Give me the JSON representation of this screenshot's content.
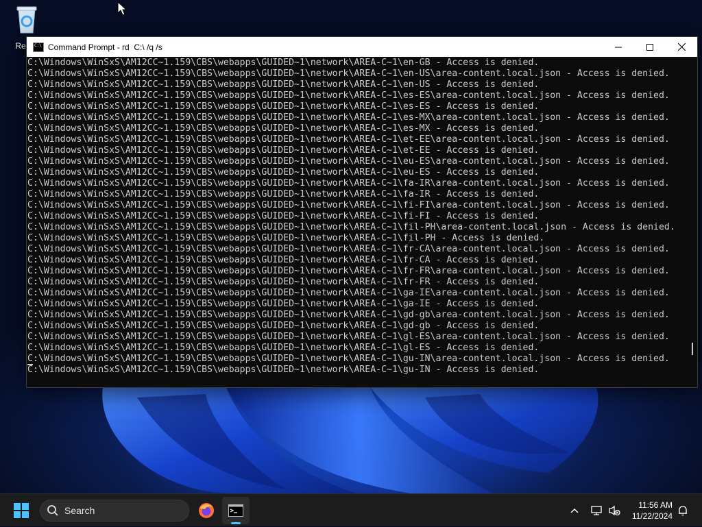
{
  "desktop": {
    "recycle_bin_label": "Recyc"
  },
  "window": {
    "title": "Command Prompt - rd  C:\\ /q /s",
    "controls": {
      "minimize": "minimize-icon",
      "maximize": "maximize-icon",
      "close": "close-icon"
    },
    "console_lines": [
      "C:\\Windows\\WinSxS\\AM12CC~1.159\\CBS\\webapps\\GUIDED~1\\network\\AREA-C~1\\en-GB - Access is denied.",
      "C:\\Windows\\WinSxS\\AM12CC~1.159\\CBS\\webapps\\GUIDED~1\\network\\AREA-C~1\\en-US\\area-content.local.json - Access is denied.",
      "C:\\Windows\\WinSxS\\AM12CC~1.159\\CBS\\webapps\\GUIDED~1\\network\\AREA-C~1\\en-US - Access is denied.",
      "C:\\Windows\\WinSxS\\AM12CC~1.159\\CBS\\webapps\\GUIDED~1\\network\\AREA-C~1\\es-ES\\area-content.local.json - Access is denied.",
      "C:\\Windows\\WinSxS\\AM12CC~1.159\\CBS\\webapps\\GUIDED~1\\network\\AREA-C~1\\es-ES - Access is denied.",
      "C:\\Windows\\WinSxS\\AM12CC~1.159\\CBS\\webapps\\GUIDED~1\\network\\AREA-C~1\\es-MX\\area-content.local.json - Access is denied.",
      "C:\\Windows\\WinSxS\\AM12CC~1.159\\CBS\\webapps\\GUIDED~1\\network\\AREA-C~1\\es-MX - Access is denied.",
      "C:\\Windows\\WinSxS\\AM12CC~1.159\\CBS\\webapps\\GUIDED~1\\network\\AREA-C~1\\et-EE\\area-content.local.json - Access is denied.",
      "C:\\Windows\\WinSxS\\AM12CC~1.159\\CBS\\webapps\\GUIDED~1\\network\\AREA-C~1\\et-EE - Access is denied.",
      "C:\\Windows\\WinSxS\\AM12CC~1.159\\CBS\\webapps\\GUIDED~1\\network\\AREA-C~1\\eu-ES\\area-content.local.json - Access is denied.",
      "C:\\Windows\\WinSxS\\AM12CC~1.159\\CBS\\webapps\\GUIDED~1\\network\\AREA-C~1\\eu-ES - Access is denied.",
      "C:\\Windows\\WinSxS\\AM12CC~1.159\\CBS\\webapps\\GUIDED~1\\network\\AREA-C~1\\fa-IR\\area-content.local.json - Access is denied.",
      "C:\\Windows\\WinSxS\\AM12CC~1.159\\CBS\\webapps\\GUIDED~1\\network\\AREA-C~1\\fa-IR - Access is denied.",
      "C:\\Windows\\WinSxS\\AM12CC~1.159\\CBS\\webapps\\GUIDED~1\\network\\AREA-C~1\\fi-FI\\area-content.local.json - Access is denied.",
      "C:\\Windows\\WinSxS\\AM12CC~1.159\\CBS\\webapps\\GUIDED~1\\network\\AREA-C~1\\fi-FI - Access is denied.",
      "C:\\Windows\\WinSxS\\AM12CC~1.159\\CBS\\webapps\\GUIDED~1\\network\\AREA-C~1\\fil-PH\\area-content.local.json - Access is denied.",
      "C:\\Windows\\WinSxS\\AM12CC~1.159\\CBS\\webapps\\GUIDED~1\\network\\AREA-C~1\\fil-PH - Access is denied.",
      "C:\\Windows\\WinSxS\\AM12CC~1.159\\CBS\\webapps\\GUIDED~1\\network\\AREA-C~1\\fr-CA\\area-content.local.json - Access is denied.",
      "C:\\Windows\\WinSxS\\AM12CC~1.159\\CBS\\webapps\\GUIDED~1\\network\\AREA-C~1\\fr-CA - Access is denied.",
      "C:\\Windows\\WinSxS\\AM12CC~1.159\\CBS\\webapps\\GUIDED~1\\network\\AREA-C~1\\fr-FR\\area-content.local.json - Access is denied.",
      "C:\\Windows\\WinSxS\\AM12CC~1.159\\CBS\\webapps\\GUIDED~1\\network\\AREA-C~1\\fr-FR - Access is denied.",
      "C:\\Windows\\WinSxS\\AM12CC~1.159\\CBS\\webapps\\GUIDED~1\\network\\AREA-C~1\\ga-IE\\area-content.local.json - Access is denied.",
      "C:\\Windows\\WinSxS\\AM12CC~1.159\\CBS\\webapps\\GUIDED~1\\network\\AREA-C~1\\ga-IE - Access is denied.",
      "C:\\Windows\\WinSxS\\AM12CC~1.159\\CBS\\webapps\\GUIDED~1\\network\\AREA-C~1\\gd-gb\\area-content.local.json - Access is denied.",
      "C:\\Windows\\WinSxS\\AM12CC~1.159\\CBS\\webapps\\GUIDED~1\\network\\AREA-C~1\\gd-gb - Access is denied.",
      "C:\\Windows\\WinSxS\\AM12CC~1.159\\CBS\\webapps\\GUIDED~1\\network\\AREA-C~1\\gl-ES\\area-content.local.json - Access is denied.",
      "C:\\Windows\\WinSxS\\AM12CC~1.159\\CBS\\webapps\\GUIDED~1\\network\\AREA-C~1\\gl-ES - Access is denied.",
      "C:\\Windows\\WinSxS\\AM12CC~1.159\\CBS\\webapps\\GUIDED~1\\network\\AREA-C~1\\gu-IN\\area-content.local.json - Access is denied.",
      "C:\\Windows\\WinSxS\\AM12CC~1.159\\CBS\\webapps\\GUIDED~1\\network\\AREA-C~1\\gu-IN - Access is denied."
    ]
  },
  "taskbar": {
    "search_placeholder": "Search",
    "apps": [
      "firefox-icon",
      "terminal-icon"
    ],
    "active_app": "terminal-icon",
    "tray_icons": [
      "chevron-up-icon",
      "network-icon",
      "volume-muted-icon",
      "notification-bell-icon"
    ],
    "time": "11:56 AM",
    "date": "11/22/2024",
    "accent_color": "#4cc2ff"
  }
}
